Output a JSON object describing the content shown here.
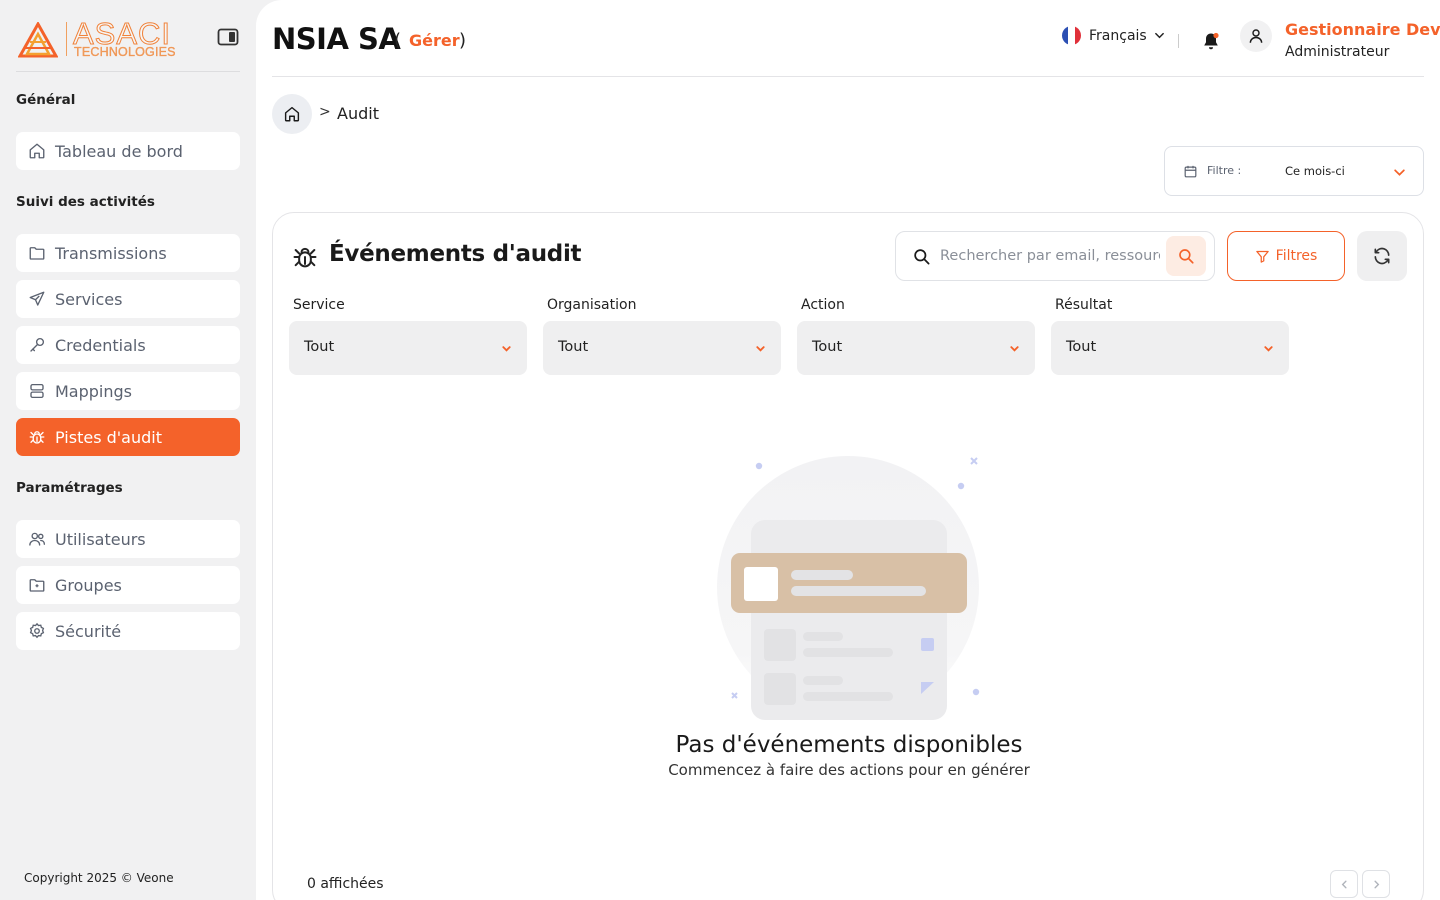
{
  "brand": {
    "name": "ASACI",
    "subtitle": "TECHNOLOGIES"
  },
  "sidebar": {
    "sections": [
      {
        "title": "Général"
      },
      {
        "title": "Suivi des activités"
      },
      {
        "title": "Paramétrages"
      }
    ],
    "items": [
      {
        "label": "Tableau de bord",
        "icon": "home-icon"
      },
      {
        "label": "Transmissions",
        "icon": "folder-icon"
      },
      {
        "label": "Services",
        "icon": "send-icon"
      },
      {
        "label": "Credentials",
        "icon": "key-icon"
      },
      {
        "label": "Mappings",
        "icon": "database-icon"
      },
      {
        "label": "Pistes d'audit",
        "icon": "bug-icon",
        "active": true
      },
      {
        "label": "Utilisateurs",
        "icon": "users-icon"
      },
      {
        "label": "Groupes",
        "icon": "folder-group-icon"
      },
      {
        "label": "Sécurité",
        "icon": "gear-icon"
      }
    ],
    "copyright": "Copyright 2025 © Veone"
  },
  "header": {
    "org_name": "NSIA SA",
    "paren_open": "(",
    "manage_link": "Gérer",
    "paren_close": ")",
    "language": "Français",
    "user_name": "Gestionnaire Dev",
    "user_role": "Administrateur"
  },
  "breadcrumb": {
    "separator": ">",
    "current": "Audit"
  },
  "period_filter": {
    "label": "Filtre :",
    "value": "Ce mois-ci"
  },
  "card": {
    "title": "Événements d'audit",
    "search_placeholder": "Rechercher par email, ressource...",
    "filters_label": "Filtres",
    "filters": [
      {
        "label": "Service",
        "value": "Tout"
      },
      {
        "label": "Organisation",
        "value": "Tout"
      },
      {
        "label": "Action",
        "value": "Tout"
      },
      {
        "label": "Résultat",
        "value": "Tout"
      }
    ],
    "empty_title": "Pas d'événements disponibles",
    "empty_subtitle": "Commencez à faire des actions pour en générer",
    "count_text": "0 affichées"
  },
  "colors": {
    "accent": "#f4622a",
    "sidebar_bg": "#f1f1f2",
    "muted_text": "#5b6270"
  }
}
